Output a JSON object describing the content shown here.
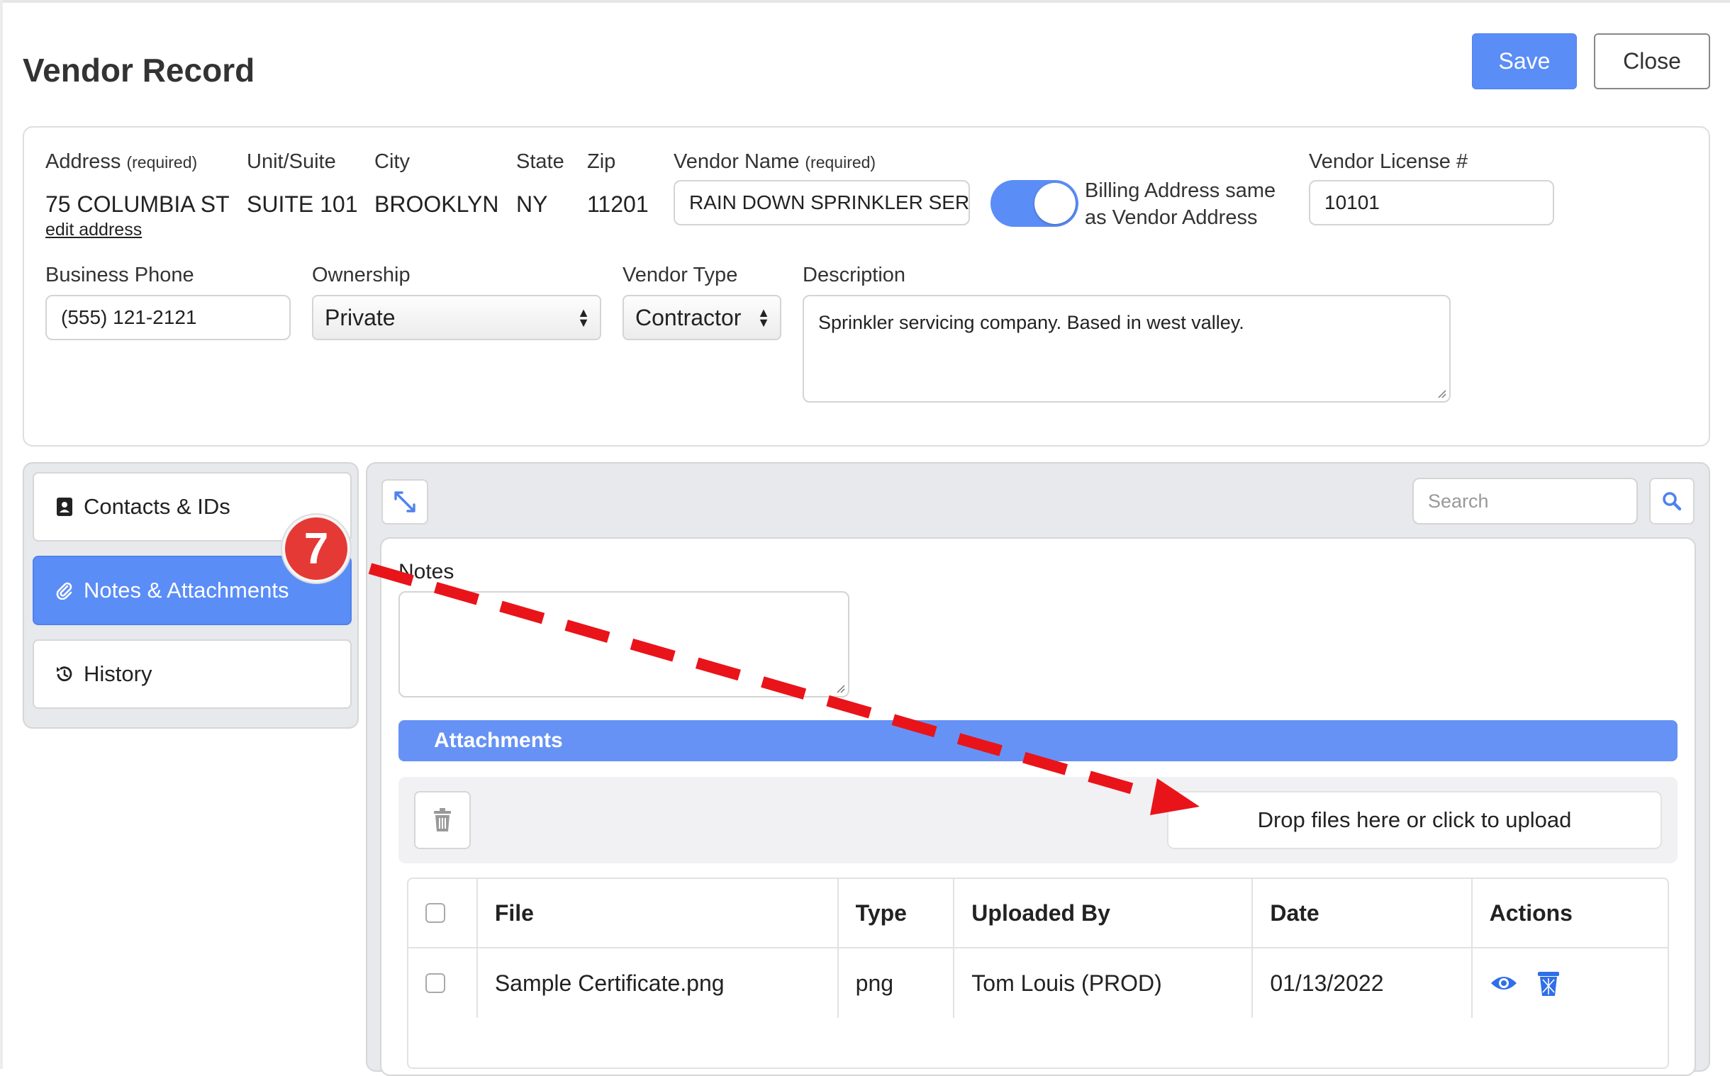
{
  "page": {
    "title": "Vendor Record"
  },
  "toolbar": {
    "save_label": "Save",
    "close_label": "Close"
  },
  "vendor": {
    "address_label": "Address",
    "required_note": "(required)",
    "address_value": "75 COLUMBIA ST",
    "edit_address_link": "edit address",
    "unit_label": "Unit/Suite",
    "unit_value": "SUITE 101",
    "city_label": "City",
    "city_value": "BROOKLYN",
    "state_label": "State",
    "state_value": "NY",
    "zip_label": "Zip",
    "zip_value": "11201",
    "name_label": "Vendor Name",
    "name_value": "RAIN DOWN SPRINKLER SER",
    "billing_same_label_1": "Billing Address same",
    "billing_same_label_2": "as Vendor Address",
    "billing_same_on": true,
    "license_label": "Vendor License #",
    "license_value": "10101",
    "phone_label": "Business Phone",
    "phone_value": "(555) 121-2121",
    "ownership_label": "Ownership",
    "ownership_value": "Private",
    "type_label": "Vendor Type",
    "type_value": "Contractor",
    "description_label": "Description",
    "description_value": "Sprinkler servicing company. Based in west valley."
  },
  "sidebar": {
    "items": [
      {
        "label": "Contacts & IDs",
        "icon": "contact-card-icon",
        "active": false
      },
      {
        "label": "Notes & Attachments",
        "icon": "paperclip-icon",
        "active": true
      },
      {
        "label": "History",
        "icon": "history-icon",
        "active": false
      }
    ]
  },
  "main": {
    "search_placeholder": "Search",
    "notes_label": "Notes",
    "notes_value": "",
    "attachments_title": "Attachments",
    "drop_zone_text": "Drop files here or click to upload",
    "table": {
      "columns": [
        "File",
        "Type",
        "Uploaded By",
        "Date",
        "Actions"
      ],
      "rows": [
        {
          "file": "Sample Certificate.png",
          "type": "png",
          "uploaded_by": "Tom Louis (PROD)",
          "date": "01/13/2022"
        }
      ]
    }
  },
  "annotation": {
    "step_number": "7"
  },
  "colors": {
    "accent": "#5b8df7",
    "annotation_red": "#e53935"
  }
}
